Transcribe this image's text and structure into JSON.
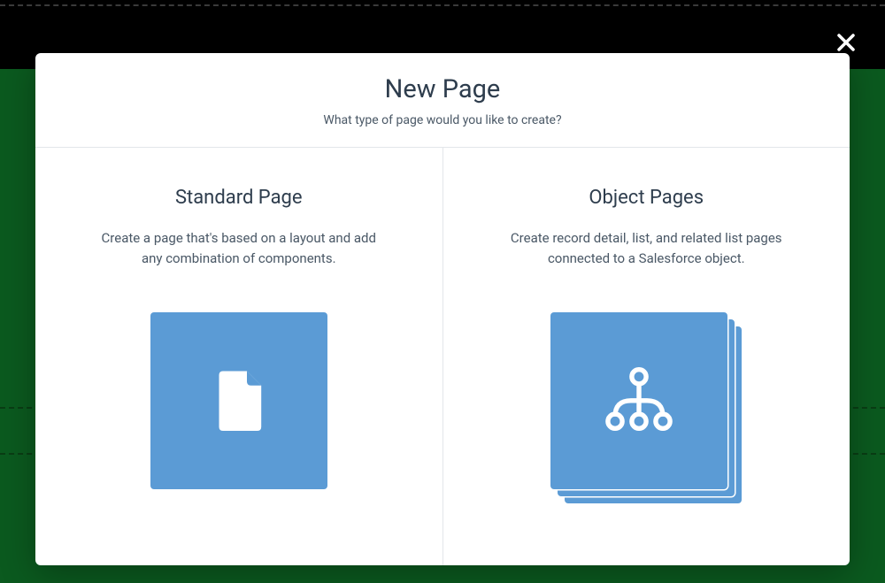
{
  "modal": {
    "title": "New Page",
    "subtitle": "What type of page would you like to create?",
    "options": [
      {
        "title": "Standard Page",
        "description": "Create a page that's based on a layout and add any combination of components."
      },
      {
        "title": "Object Pages",
        "description": "Create record detail, list, and related list pages connected to a Salesforce object."
      }
    ]
  }
}
